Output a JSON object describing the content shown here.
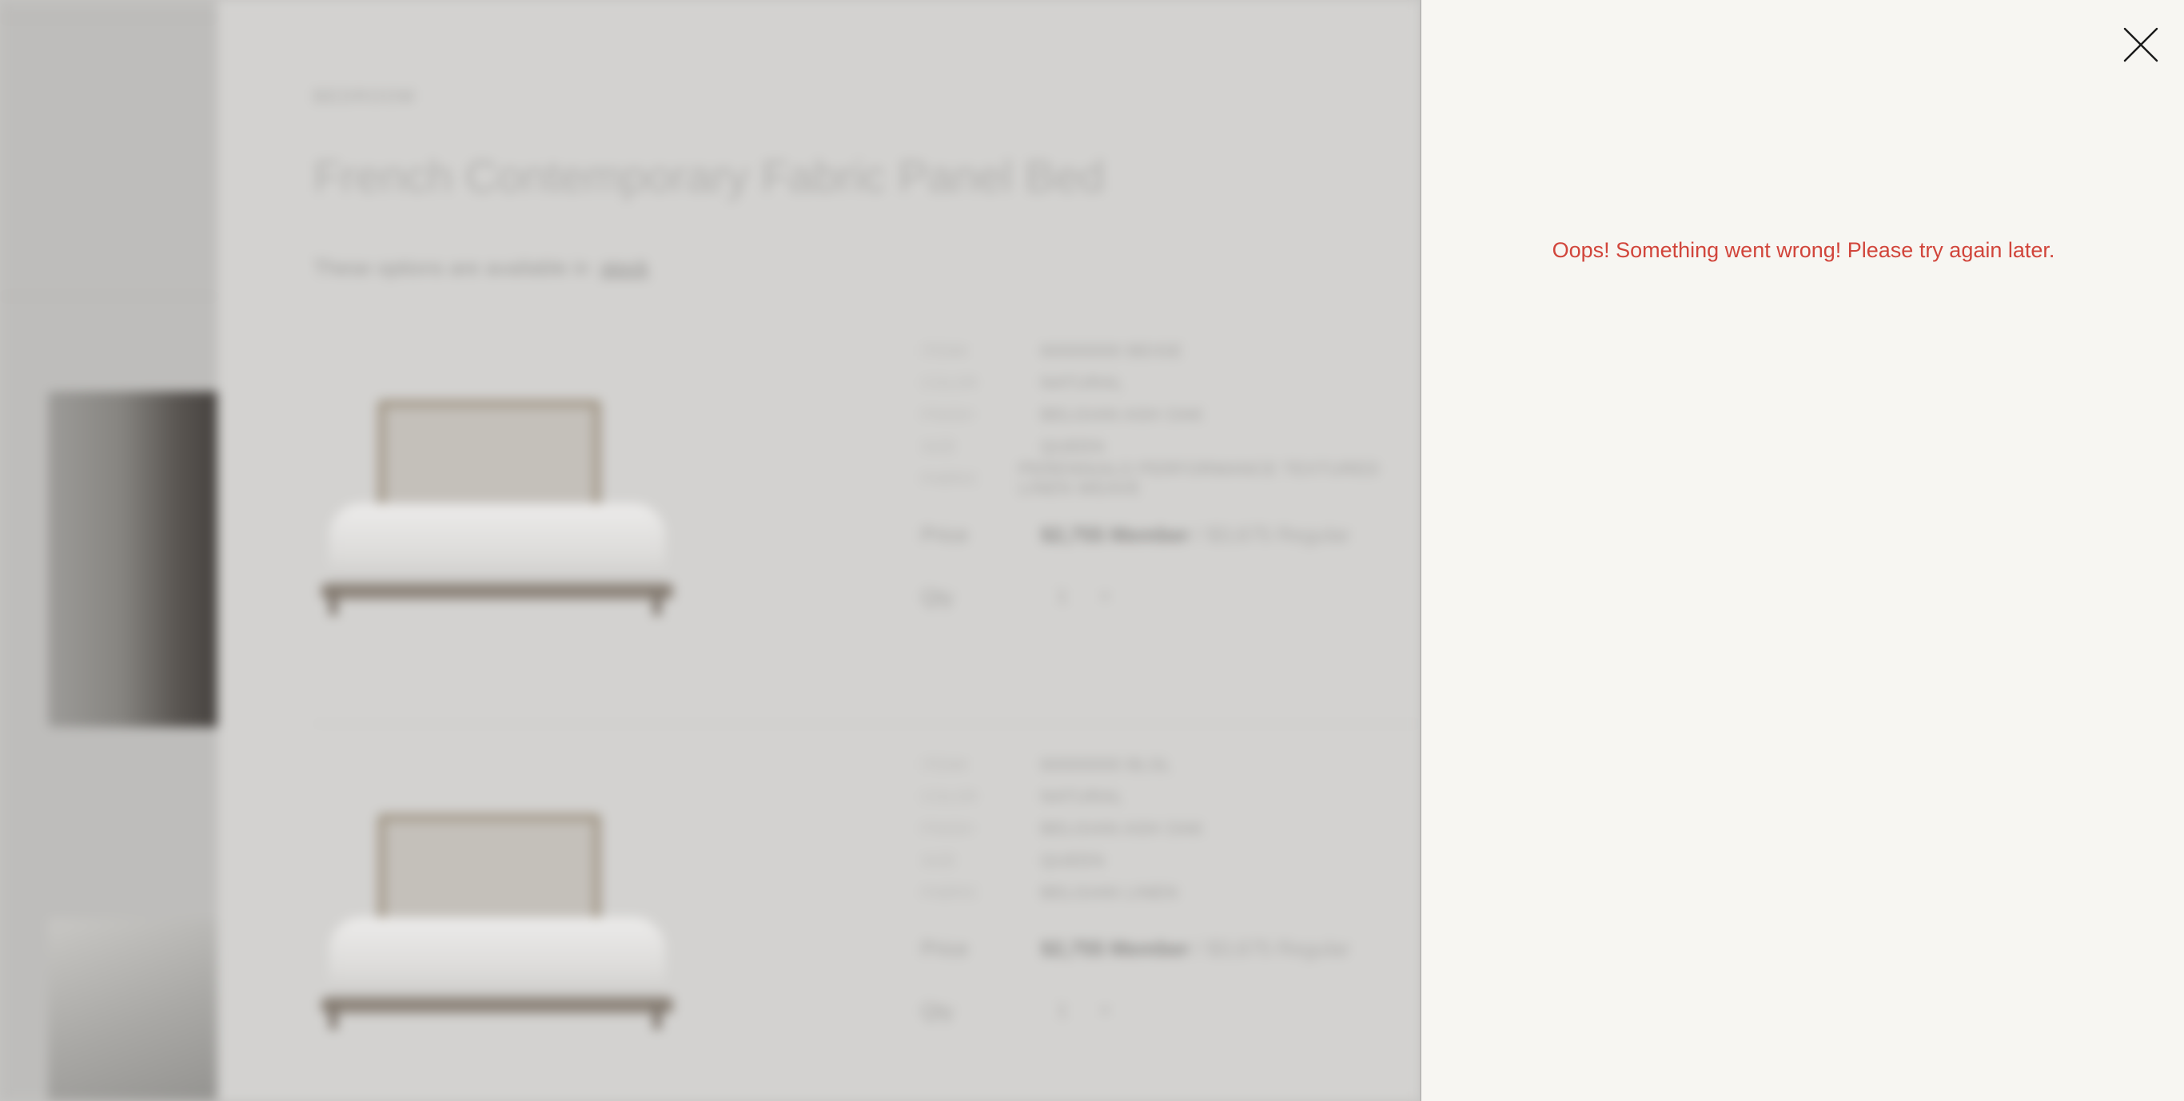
{
  "background": {
    "product_panel": {
      "section_label": "BEDROOM",
      "title": "French Contemporary Fabric Panel Bed",
      "availability_note": "These options are available in",
      "availability_link": "stock",
      "items": [
        {
          "specs": [
            {
              "label": "ITEM#",
              "value": "60000000 BEIGE"
            },
            {
              "label": "COLOR",
              "value": "NATURAL"
            },
            {
              "label": "FINISH",
              "value": "BELGIAN ASH OAK"
            },
            {
              "label": "SIZE",
              "value": "QUEEN"
            },
            {
              "label": "FABRIC",
              "value": "PERENNIALS PERFORMANCE TEXTURED LINEN WEAVE"
            }
          ],
          "price_label": "Price",
          "price_member": "$2,755 Member",
          "price_regular": "/ $3,675 Regular",
          "qty_label": "Qty",
          "qty_value": "1",
          "qty_plus": "+"
        },
        {
          "specs": [
            {
              "label": "ITEM#",
              "value": "60000000 BLSL"
            },
            {
              "label": "COLOR",
              "value": "NATURAL"
            },
            {
              "label": "FINISH",
              "value": "BELGIAN ASH OAK"
            },
            {
              "label": "SIZE",
              "value": "QUEEN"
            },
            {
              "label": "FABRIC",
              "value": "BELGIAN LINEN"
            }
          ],
          "price_label": "Price",
          "price_member": "$2,755 Member",
          "price_regular": "/ $3,675 Regular",
          "qty_label": "Qty",
          "qty_value": "1",
          "qty_plus": "+"
        }
      ]
    }
  },
  "drawer": {
    "close_icon": "close-x-icon",
    "error_message": "Oops! Something went wrong! Please try again later.",
    "error_color": "#d1453b",
    "background_color": "#f7f6f2"
  }
}
